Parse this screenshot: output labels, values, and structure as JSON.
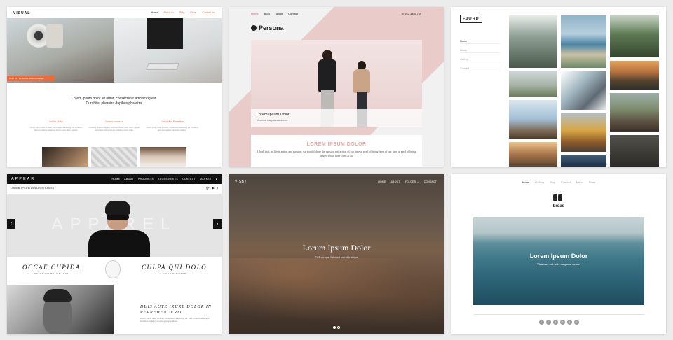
{
  "themes": {
    "visual": {
      "logo": "VISUAL",
      "nav": [
        "Home",
        "About Us",
        "Blog",
        "News",
        "Contact Us"
      ],
      "hero_caption": "Color ful",
      "hero_caption_sub": "Ineffective dream paradigm",
      "tagline_1": "Lorem ipsum dolor sit amet, consectetur adipiscing elit.",
      "tagline_2": "Curabitur pharetra dapibus pharetra.",
      "columns": [
        {
          "title": "Nullla Nulla",
          "text": "Lorem ipsum dolor sit amet, consectetur adipiscing elit. Curabitur pharetra dapibus pharetra. Donec tortor dolor, sagittis."
        },
        {
          "title": "Donec maxium",
          "text": "Curabitur pharetra dapibus pharetra. Donec tortor dolor, sagittis venenatis massa semper, sodales cursus nulla."
        },
        {
          "title": "Curabitur Pharetra",
          "text": "Lorem ipsum dolor sit amet, consectetur adipiscing elit. Curabitur pharetra dapibus pharetra sodales."
        }
      ],
      "accent": "#ee6a3b"
    },
    "persona": {
      "nav": [
        "Home",
        "Blog",
        "About",
        "Contact"
      ],
      "phone": "☏ 012 3456 789",
      "brand": "Persona",
      "caption_title": "Lorem Ipsum Dolor",
      "caption_sub": "Vivamus magnus est dolore.",
      "section_title": "LOREM IPSUM DOLOR",
      "section_text": "I think that, as life is action and passion, we should share the passion and action of our time at peril of being been of our time at peril of being judged not to have lived at all.",
      "accent": "#e4617c"
    },
    "fjord": {
      "logo": "F3ORD",
      "menu": [
        "Home",
        "About",
        "Gallery",
        "Contact"
      ]
    },
    "appear": {
      "logo": "APPEAR",
      "nav": [
        "HOME",
        "ABOUT",
        "PRODUCTS",
        "ACCESSORIES",
        "CONTACT",
        "MARKET"
      ],
      "subheader": "LOREM IPSUM DOLOR SIT AMET",
      "social": [
        "f",
        "g+",
        "▶",
        "t"
      ],
      "hero_word": "APPAREL",
      "left_title": "OCCAE CUPIDA",
      "left_sub": "DESERUNT MOLLIT ANIM",
      "right_title": "CULPA QUI DOLO",
      "right_sub": "NOLLA PARIATUR",
      "feature_title": "DUIS AUTE IRURE DOLOR IN REPREHENDERIT",
      "feature_text": "Lorem ipsum dolor sit amet, consectetur adipiscing elit. Sed do eiusmod tempor incididunt ut labore et dolore magna aliqua."
    },
    "visby": {
      "logo": "VISBY",
      "nav": [
        "HOME",
        "ABOUT",
        "FOLDER ⌄",
        "CONTACT"
      ],
      "title": "Lorum Ipsum Dolor",
      "subtitle": "Pellentesque habitant morbi tristique"
    },
    "broad": {
      "nav": [
        "Home",
        "Gallery",
        "Blog",
        "Contact",
        "Menu",
        "Store"
      ],
      "brand": "broad",
      "title": "Lorem Ipsum Dolor",
      "subtitle": "Vivamus est felis magnus somet",
      "social": [
        "t",
        "f",
        "g",
        "in",
        "p",
        "◎"
      ]
    }
  }
}
